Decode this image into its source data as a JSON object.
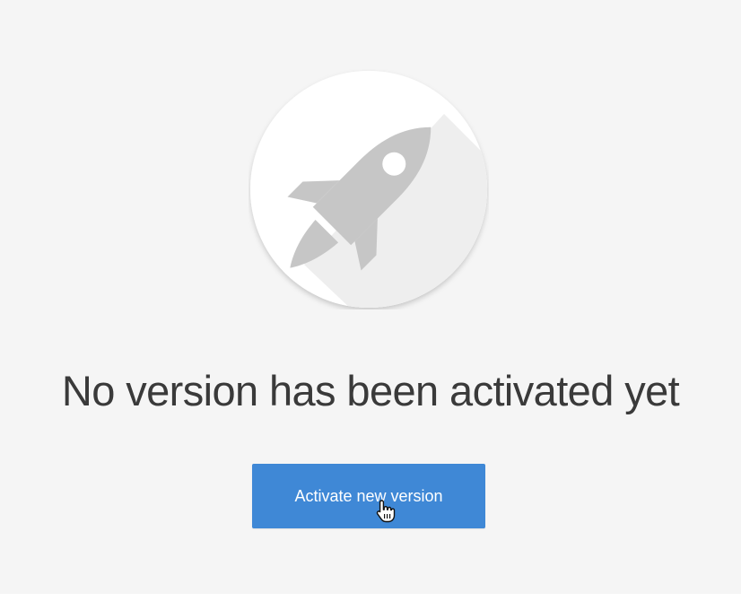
{
  "empty_state": {
    "heading": "No version has been activated yet",
    "illustration_icon": "rocket-icon",
    "button_label": "Activate new version"
  },
  "cursor": {
    "icon": "hand-pointer-icon"
  },
  "colors": {
    "page_background": "#f5f5f5",
    "button_background": "#3f88d6",
    "button_text": "#ffffff",
    "heading_text": "#3a3a3a",
    "icon_gray": "#c4c4c4",
    "circle_background": "#ffffff"
  }
}
